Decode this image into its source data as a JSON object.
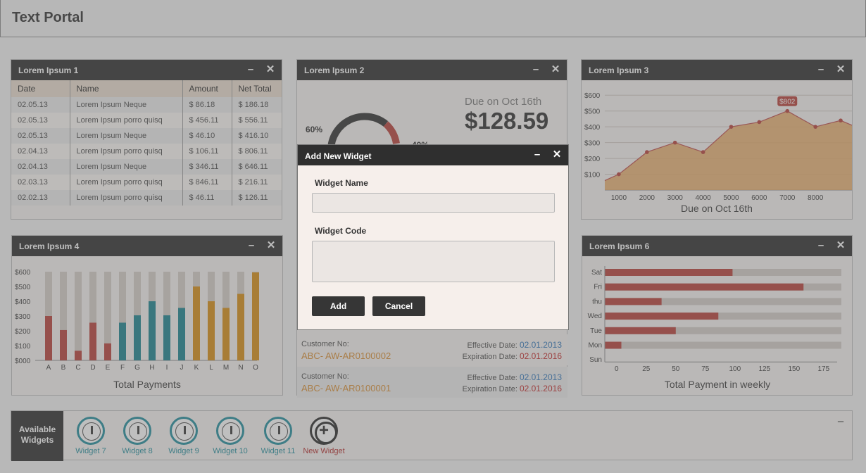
{
  "app": {
    "title": "Text Portal"
  },
  "widgets": {
    "w1": {
      "title": "Lorem Ipsum 1",
      "columns": [
        "Date",
        "Name",
        "Amount",
        "Net Total"
      ],
      "rows": [
        [
          "02.05.13",
          "Lorem Ipsum Neque",
          "$ 86.18",
          "$ 186.18"
        ],
        [
          "02.05.13",
          "Lorem Ipsum porro quisq",
          "$ 456.11",
          "$ 556.11"
        ],
        [
          "02.05.13",
          "Lorem Ipsum Neque",
          "$ 46.10",
          "$ 416.10"
        ],
        [
          "02.04.13",
          "Lorem Ipsum porro quisq",
          "$ 106.11",
          "$ 806.11"
        ],
        [
          "02.04.13",
          "Lorem Ipsum Neque",
          "$ 346.11",
          "$ 646.11"
        ],
        [
          "02.03.13",
          "Lorem Ipsum porro quisq",
          "$ 846.11",
          "$ 216.11"
        ],
        [
          "02.02.13",
          "Lorem Ipsum porro quisq",
          "$ 46.11",
          "$ 126.11"
        ]
      ]
    },
    "w2": {
      "title": "Lorem Ipsum 2",
      "due_label": "Due on Oct 16th",
      "due_amount": "$128.59",
      "pct_left": "60%",
      "pct_right": "40%",
      "customers": [
        {
          "label": "Customer No:",
          "number": "ABC- AW-AR0100002",
          "eff_label": "Effective Date:",
          "eff_date": "02.01.2013",
          "exp_label": "Expiration Date:",
          "exp_date": "02.01.2016"
        },
        {
          "label": "Customer No:",
          "number": "ABC- AW-AR0100001",
          "eff_label": "Effective Date:",
          "eff_date": "02.01.2013",
          "exp_label": "Expiration Date:",
          "exp_date": "02.01.2016"
        }
      ]
    },
    "w3": {
      "title": "Lorem Ipsum 3",
      "caption": "Due on Oct 16th",
      "callout": "$802"
    },
    "w4": {
      "title": "Lorem Ipsum 4",
      "caption": "Total Payments"
    },
    "w6": {
      "title": "Lorem Ipsum 6",
      "caption": "Total Payment in weekly"
    }
  },
  "tray": {
    "label_line1": "Available",
    "label_line2": "Widgets",
    "items": [
      "Widget 7",
      "Widget 8",
      "Widget 9",
      "Widget 10",
      "Widget 11"
    ],
    "new_label": "New Widget"
  },
  "modal": {
    "title": "Add New Widget",
    "name_label": "Widget Name",
    "name_value": "",
    "code_label": "Widget Code",
    "code_value": "",
    "add_label": "Add",
    "cancel_label": "Cancel"
  },
  "controls": {
    "minimize": "–",
    "close": "✕"
  },
  "colors": {
    "red": "#b73a32",
    "teal": "#137f8c",
    "orange": "#d68a0c",
    "area": "#e6a55a",
    "header": "#262626"
  },
  "chart_data": [
    {
      "type": "area",
      "x": [
        500,
        1000,
        2000,
        3000,
        4000,
        5000,
        6000,
        7000,
        8000,
        8900
      ],
      "values": [
        60,
        100,
        240,
        300,
        240,
        400,
        430,
        500,
        400,
        440
      ],
      "yticks": [
        "$100",
        "$200",
        "$300",
        "$400",
        "$500",
        "$600"
      ],
      "xticks": [
        "1000",
        "2000",
        "3000",
        "4000",
        "5000",
        "6000",
        "7000",
        "8000"
      ],
      "ylim": [
        0,
        650
      ],
      "xlim": [
        500,
        9300
      ],
      "annotation": "$802",
      "grid": true
    },
    {
      "type": "bar",
      "categories": [
        "A",
        "B",
        "C",
        "D",
        "E",
        "F",
        "G",
        "H",
        "I",
        "J",
        "K",
        "L",
        "M",
        "N",
        "O"
      ],
      "values": [
        300,
        205,
        65,
        255,
        115,
        255,
        305,
        400,
        305,
        355,
        500,
        400,
        355,
        450,
        595
      ],
      "colors": [
        "red",
        "red",
        "red",
        "red",
        "red",
        "teal",
        "teal",
        "teal",
        "teal",
        "teal",
        "orange",
        "orange",
        "orange",
        "orange",
        "orange"
      ],
      "yticks": [
        "$000",
        "$100",
        "$200",
        "$300",
        "$400",
        "$500",
        "$600"
      ],
      "ylim": [
        0,
        600
      ],
      "caption": "Total Payments"
    },
    {
      "type": "bar",
      "orientation": "horizontal",
      "categories": [
        "Sat",
        "Fri",
        "thu",
        "Wed",
        "Tue",
        "Mon",
        "Sun"
      ],
      "values": [
        98,
        158,
        38,
        86,
        50,
        4,
        0
      ],
      "xticks": [
        "0",
        "25",
        "50",
        "75",
        "100",
        "125",
        "150",
        "175"
      ],
      "xlim": [
        -10,
        190
      ],
      "caption": "Total Payment in weekly"
    },
    {
      "type": "pie",
      "values": [
        60,
        40
      ],
      "labels": [
        "60%",
        "40%"
      ]
    }
  ]
}
